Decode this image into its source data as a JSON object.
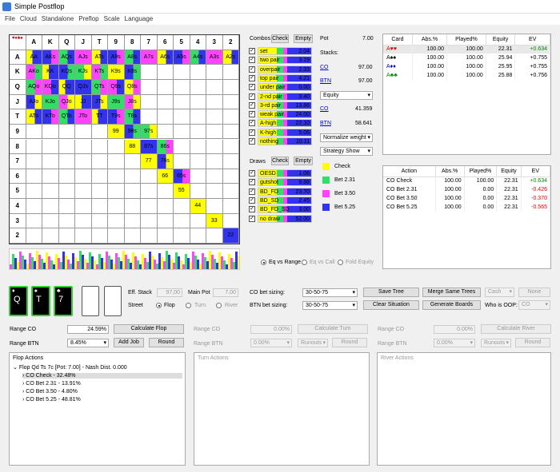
{
  "window": {
    "title": "Simple Postflop"
  },
  "menu": [
    "File",
    "Cloud",
    "Standalone",
    "Preflop",
    "Scale",
    "Language"
  ],
  "grid": {
    "headers": [
      "A",
      "K",
      "Q",
      "J",
      "T",
      "9",
      "8",
      "7",
      "6",
      "5",
      "4",
      "3",
      "2"
    ],
    "rows": [
      [
        "AA",
        "AKs",
        "AQs",
        "AJs",
        "ATs",
        "A9s",
        "A8s",
        "A7s",
        "A6s",
        "A5s",
        "A4s",
        "A3s",
        "A2s"
      ],
      [
        "AKo",
        "KK",
        "KQs",
        "KJs",
        "KTs",
        "K9s",
        "K8s",
        "",
        "",
        "",
        "",
        "",
        ""
      ],
      [
        "AQo",
        "KQo",
        "QQ",
        "QJs",
        "QTs",
        "Q9s",
        "Q8s",
        "",
        "",
        "",
        "",
        "",
        ""
      ],
      [
        "AJo",
        "KJo",
        "QJo",
        "JJ",
        "JTs",
        "J9s",
        "J8s",
        "",
        "",
        "",
        "",
        "",
        ""
      ],
      [
        "ATo",
        "KTo",
        "QTo",
        "JTo",
        "TT",
        "T9s",
        "T8s",
        "",
        "",
        "",
        "",
        "",
        ""
      ],
      [
        "",
        "",
        "",
        "",
        "",
        "99",
        "98s",
        "97s",
        "",
        "",
        "",
        "",
        ""
      ],
      [
        "",
        "",
        "",
        "",
        "",
        "",
        "88",
        "87s",
        "86s",
        "",
        "",
        "",
        ""
      ],
      [
        "",
        "",
        "",
        "",
        "",
        "",
        "",
        "77",
        "76s",
        "",
        "",
        "",
        ""
      ],
      [
        "",
        "",
        "",
        "",
        "",
        "",
        "",
        "",
        "66",
        "65s",
        "",
        "",
        ""
      ],
      [
        "",
        "",
        "",
        "",
        "",
        "",
        "",
        "",
        "",
        "55",
        "",
        "",
        ""
      ],
      [
        "",
        "",
        "",
        "",
        "",
        "",
        "",
        "",
        "",
        "",
        "44",
        "",
        ""
      ],
      [
        "",
        "",
        "",
        "",
        "",
        "",
        "",
        "",
        "",
        "",
        "",
        "33",
        ""
      ],
      [
        "",
        "",
        "",
        "",
        "",
        "",
        "",
        "",
        "",
        "",
        "",
        "",
        "22"
      ]
    ]
  },
  "combos": {
    "title": "Combos",
    "check_label": "Check",
    "empty_label": "Empty",
    "items": [
      {
        "name": "set",
        "value": "2.04"
      },
      {
        "name": "two pair",
        "value": "3.19"
      },
      {
        "name": "overpair",
        "value": "2.33"
      },
      {
        "name": "top pair",
        "value": "4.21"
      },
      {
        "name": "under pair",
        "value": "0.00"
      },
      {
        "name": "2-nd pair",
        "value": "3.40"
      },
      {
        "name": "3-rd pair",
        "value": "13.86"
      },
      {
        "name": "weak pair",
        "value": "24.00"
      },
      {
        "name": "A-high",
        "value": "22.10"
      },
      {
        "name": "K-high",
        "value": "5.06"
      },
      {
        "name": "nothing",
        "value": "10.11"
      }
    ]
  },
  "draws": {
    "title": "Draws",
    "check_label": "Check",
    "empty_label": "Empty",
    "items": [
      {
        "name": "OESD",
        "value": "1.06"
      },
      {
        "name": "gutshot",
        "value": "9.88"
      },
      {
        "name": "BD_FD",
        "value": "23.70"
      },
      {
        "name": "BD_SD",
        "value": "2.45"
      },
      {
        "name": "BD_FD_SD",
        "value": "3.00"
      },
      {
        "name": "no draw",
        "value": "52.00"
      }
    ]
  },
  "pot": {
    "label": "Pot",
    "value": "7.00",
    "stacks_label": "Stacks:",
    "co_label": "CO",
    "co_value": "97.00",
    "btn_label": "BTN",
    "btn_value": "97.00"
  },
  "equity_select": "Equity",
  "equity": {
    "co_label": "CO",
    "co_value": "41.359",
    "btn_label": "BTN",
    "btn_value": "58.641"
  },
  "normalize_select": "Normalize weight",
  "strategy_select": "Strategy Show",
  "legend": [
    {
      "label": "Check",
      "color": "#ffff00"
    },
    {
      "label": "Bet 2.31",
      "color": "#33dd66"
    },
    {
      "label": "Bet 3.50",
      "color": "#ff44ff"
    },
    {
      "label": "Bet 5.25",
      "color": "#3333ee"
    }
  ],
  "card_table": {
    "headers": [
      "Card",
      "Abs.%",
      "Played%",
      "Equity",
      "EV"
    ],
    "rows": [
      {
        "card": "A♥♥",
        "suit_color": "#d00",
        "abs": "100.00",
        "played": "100.00",
        "equity": "22.31",
        "ev": "+0.634",
        "ev_color": "#080"
      },
      {
        "card": "A♠♠",
        "suit_color": "#000",
        "abs": "100.00",
        "played": "100.00",
        "equity": "25.94",
        "ev": "+0.755",
        "ev_color": "#000"
      },
      {
        "card": "A♦♦",
        "suit_color": "#00c",
        "abs": "100.00",
        "played": "100.00",
        "equity": "25.95",
        "ev": "+0.755",
        "ev_color": "#000"
      },
      {
        "card": "A♣♣",
        "suit_color": "#080",
        "abs": "100.00",
        "played": "100.00",
        "equity": "25.88",
        "ev": "+0.756",
        "ev_color": "#000"
      }
    ]
  },
  "action_table": {
    "headers": [
      "Action",
      "Abs.%",
      "Played%",
      "Equity",
      "EV"
    ],
    "rows": [
      {
        "action": "CO Check",
        "abs": "100.00",
        "played": "100.00",
        "equity": "22.31",
        "ev": "+0.634",
        "ev_color": "#080"
      },
      {
        "action": "CO Bet 2.31",
        "abs": "100.00",
        "played": "0.00",
        "equity": "22.31",
        "ev": "-0.426",
        "ev_color": "#d00"
      },
      {
        "action": "CO Bet 3.50",
        "abs": "100.00",
        "played": "0.00",
        "equity": "22.31",
        "ev": "-0.370",
        "ev_color": "#d00"
      },
      {
        "action": "CO Bet 5.25",
        "abs": "100.00",
        "played": "0.00",
        "equity": "22.31",
        "ev": "-0.565",
        "ev_color": "#d00"
      }
    ]
  },
  "eq_radios": {
    "eq_vs_range": "Eq vs Range",
    "eq_vs_call": "Eq vs Call",
    "fold_equity": "Fold Equity"
  },
  "board": {
    "cards": [
      {
        "rank": "Q",
        "suit": "♦"
      },
      {
        "rank": "T",
        "suit": "♠"
      },
      {
        "rank": "7",
        "suit": "♣"
      }
    ]
  },
  "controls": {
    "eff_stack_label": "Eff. Stack",
    "eff_stack": "97,00",
    "main_pot_label": "Main Pot",
    "main_pot": "7,00",
    "street_label": "Street",
    "flop": "Flop",
    "turn": "Turn",
    "river": "River",
    "co_bet_label": "CO bet sizing:",
    "co_bet": "30-50-75",
    "btn_bet_label": "BTN bet sizing:",
    "btn_bet": "30-50-75",
    "save_tree": "Save Tree",
    "merge_trees": "Merge Same Trees",
    "cash": "Cash",
    "none": "None",
    "clear_situation": "Clear Situation",
    "generate_boards": "Generate Boards",
    "who_oop": "Who is OOP:",
    "oop_value": "CO"
  },
  "flop_ctrl": {
    "range_co": "Range CO",
    "range_co_val": "24.59%",
    "range_btn": "Range BTN",
    "range_btn_val": "8.45%",
    "calc": "Calculate Flop",
    "add_job": "Add Job",
    "round": "Round"
  },
  "turn_ctrl": {
    "range_co": "Range CO",
    "range_co_val": "0.00%",
    "range_btn": "Range BTN",
    "range_btn_val": "0.00%",
    "calc": "Calculate Turn",
    "runouts": "Runouts",
    "round": "Round"
  },
  "river_ctrl": {
    "range_co": "Range CO",
    "range_co_val": "0.00%",
    "range_btn": "Range BTN",
    "range_btn_val": "0.00%",
    "calc": "Calculate River",
    "runouts": "Runouts",
    "round": "Round"
  },
  "flop_actions": {
    "title": "Flop Actions",
    "root": "Flop Qd Ts 7c [Pot: 7.00] - Nash Dist. 0.000",
    "items": [
      "CO Check - 32.48%",
      "CO Bet 2.31 - 13.91%",
      "CO Bet 3.50 - 4.80%",
      "CO Bet 5.25 - 48.81%"
    ]
  },
  "turn_actions": {
    "title": "Turn Actions"
  },
  "river_actions": {
    "title": "River Actions"
  }
}
